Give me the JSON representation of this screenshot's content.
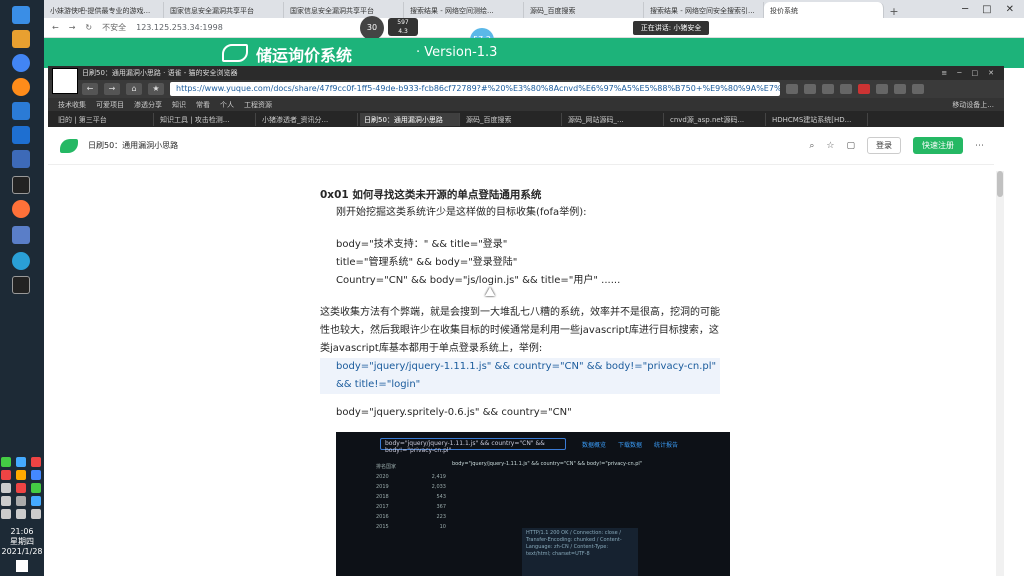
{
  "taskbar": {
    "clock": {
      "time": "21:06",
      "day": "星期四",
      "date": "2021/1/28"
    }
  },
  "outer_browser": {
    "tabs": [
      {
        "label": "小妹游侠吧-提供最专业的游戏..."
      },
      {
        "label": "国家信息安全漏洞共享平台"
      },
      {
        "label": "国家信息安全漏洞共享平台"
      },
      {
        "label": "搜索结果 - 网络空间测绘..."
      },
      {
        "label": "源码_百度搜索"
      },
      {
        "label": "搜索结果 - 网络空间安全搜索引..."
      },
      {
        "label": "投价系统"
      }
    ],
    "url_prefix": "不安全",
    "url": "123.125.253.34:1998",
    "badges": {
      "cpu": "30",
      "net_up": "597",
      "net_down": "4.3",
      "speed": "57.2"
    },
    "notice": "正在讲话: 小猪安全"
  },
  "banner": {
    "title": "储运询价系统",
    "version": "· Version-1.3"
  },
  "inner_browser": {
    "title": "日刷50：通用漏洞小思路 · 语雀 - 猫的安全浏览器",
    "url": "https://www.yuque.com/docs/share/47f9cc0f-1ff5-49de-b933-fcb86cf72789?#%20%E3%80%8Acnvd%E6%97%A5%E5%88%B750+%E9%80%9A%E7%94%A8",
    "bookmarks": [
      "技术收集",
      "可爱项目",
      "渗透分享",
      "知识",
      "常看",
      "个人",
      "工程资源"
    ],
    "bookmark_right": "移动设备上...",
    "tabs": [
      {
        "label": "旧的 | 第三平台"
      },
      {
        "label": "知识工具 | 攻击检测..."
      },
      {
        "label": "小猪渗透者_资讯分..."
      },
      {
        "label": "日刷50：通用漏洞小思路"
      },
      {
        "label": "源码_百度搜索"
      },
      {
        "label": "源码_网站源码_..."
      },
      {
        "label": "cnvd源_asp.net源码..."
      },
      {
        "label": "HDHCMS建站系统[HD..."
      }
    ]
  },
  "doc_header": {
    "title": "日刷50：通用漏洞小思路",
    "login_label": "登录",
    "register_label": "快速注册"
  },
  "doc": {
    "heading": "0x01 如何寻找这类未开源的单点登陆通用系统",
    "intro": "刚开始挖掘这类系统许少是这样做的目标收集(fofa举例):",
    "query1": "body=\"技术支持：\"  && title=\"登录\"",
    "query2": "title=\"管理系统\" && body=\"登录登陆\"",
    "query3": "Country=\"CN\" && body=\"js/login.js\" && title=\"用户\"  ......",
    "para1": "这类收集方法有个弊端，就是会搜到一大堆乱七八糟的系统，效率并不是很高，挖洞的可能性也较大，然后我眼许少在收集目标的时候通常是利用一些javascript库进行目标搜索，这类javascript库基本都用于单点登录系统上，举例:",
    "query4": "body=\"jquery/jquery-1.11.1.js\" && country=\"CN\" && body!=\"privacy-cn.pl\" && title!=\"login\"",
    "query5": "body=\"jquery.spritely-0.6.js\" && country=\"CN\""
  },
  "embedded_shot": {
    "search": "body=\"jquery/jquery-1.11.1.js\" && country=\"CN\" && body!=\"privacy-cn.pl\"",
    "nav": [
      "数据概览",
      "下载数据",
      "统计报告"
    ],
    "side_title": "排名国家",
    "side_years": [
      "2020",
      "2019",
      "2018",
      "2017",
      "2016",
      "2015"
    ],
    "side_counts": [
      "2,419",
      "2,033",
      "543",
      "367",
      "223",
      "10"
    ],
    "panel": "HTTP/1.1 200 OK / Connection: close / Transfer-Encoding: chunked / Content-Language: zh-CN / Content-Type: text/html; charset=UTF-8"
  },
  "colors": {
    "accent_green": "#25b864",
    "banner_green": "#1db37a",
    "dark": "#2b2b2b"
  }
}
